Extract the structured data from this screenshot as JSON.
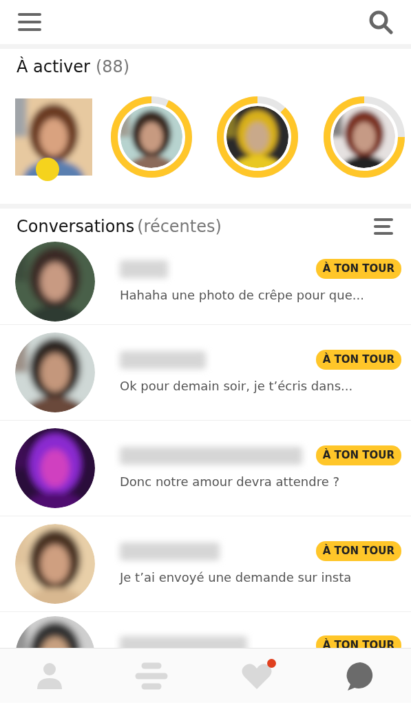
{
  "queue": {
    "title": "À activer",
    "count": "(88)",
    "items": [
      {
        "kind": "square"
      },
      {
        "kind": "ring",
        "level": 0.93
      },
      {
        "kind": "ring",
        "level": 0.88
      },
      {
        "kind": "ring",
        "level": 0.75
      }
    ]
  },
  "conversations": {
    "title": "Conversations",
    "subtitle": "(récentes)",
    "items": [
      {
        "badge": "À TON TOUR",
        "message": "Hahaha une photo de crêpe pour que..."
      },
      {
        "badge": "À TON TOUR",
        "message": "Ok pour demain soir, je t’écris dans..."
      },
      {
        "badge": "À TON TOUR",
        "message": "Donc notre amour devra attendre ?"
      },
      {
        "badge": "À TON TOUR",
        "message": "Je t’ai envoyé une demande sur insta"
      },
      {
        "badge": "À TON TOUR"
      }
    ]
  },
  "tab_bar": [
    {
      "kind": "profile",
      "selected": false,
      "notification": false
    },
    {
      "kind": "swipe",
      "selected": false,
      "notification": false
    },
    {
      "kind": "likes",
      "selected": false,
      "notification": true
    },
    {
      "kind": "chat",
      "selected": true,
      "notification": false
    }
  ]
}
